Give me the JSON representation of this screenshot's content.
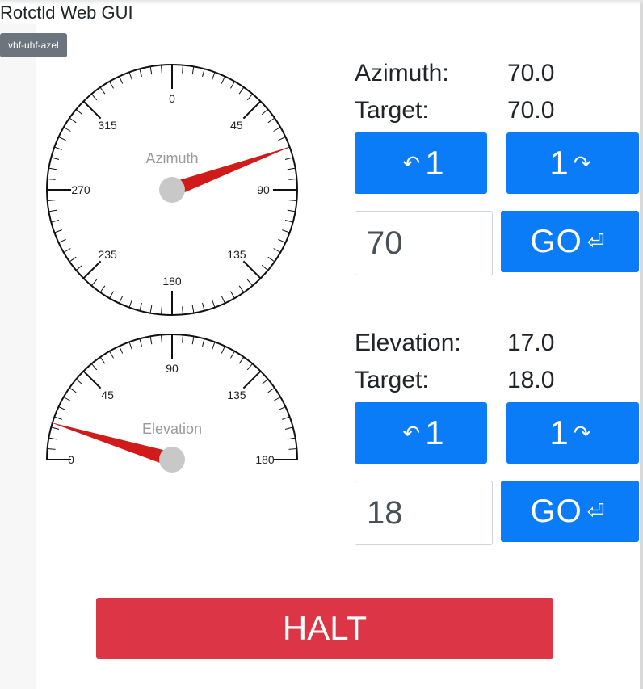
{
  "app": {
    "title": "Rotctld Web GUI",
    "rotator_badge": "vhf-uhf-azel"
  },
  "azimuth": {
    "label": "Azimuth:",
    "value": "70.0",
    "target_label": "Target:",
    "target_value": "70.0",
    "ccw_symbol": "↶",
    "ccw_step": "1",
    "cw_step": "1",
    "cw_symbol": "↷",
    "input_value": "70",
    "go_label": "GO",
    "go_symbol": "⏎",
    "gauge": {
      "title": "Azimuth",
      "ticks": [
        "0",
        "45",
        "90",
        "135",
        "180",
        "235",
        "270",
        "315"
      ],
      "needle_value": 70
    }
  },
  "elevation": {
    "label": "Elevation:",
    "value": "17.0",
    "target_label": "Target:",
    "target_value": "18.0",
    "ccw_symbol": "↶",
    "ccw_step": "1",
    "cw_step": "1",
    "cw_symbol": "↷",
    "input_value": "18",
    "go_label": "GO",
    "go_symbol": "⏎",
    "gauge": {
      "title": "Elevation",
      "ticks": [
        "0",
        "45",
        "90",
        "135",
        "180"
      ],
      "needle_value": 17
    }
  },
  "halt": {
    "label": "HALT"
  },
  "colors": {
    "primary": "#0a7cf7",
    "danger": "#dc3545",
    "badge": "#6c757d",
    "needle": "#d11a1a",
    "hub": "#c8c8c8"
  }
}
